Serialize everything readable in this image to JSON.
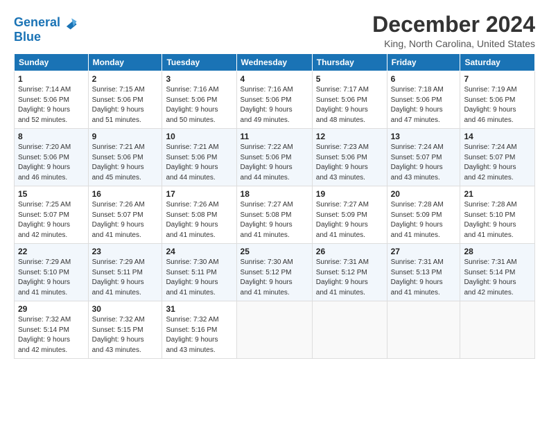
{
  "logo": {
    "line1": "General",
    "line2": "Blue"
  },
  "title": "December 2024",
  "subtitle": "King, North Carolina, United States",
  "days_of_week": [
    "Sunday",
    "Monday",
    "Tuesday",
    "Wednesday",
    "Thursday",
    "Friday",
    "Saturday"
  ],
  "weeks": [
    [
      {
        "day": "1",
        "info": "Sunrise: 7:14 AM\nSunset: 5:06 PM\nDaylight: 9 hours\nand 52 minutes."
      },
      {
        "day": "2",
        "info": "Sunrise: 7:15 AM\nSunset: 5:06 PM\nDaylight: 9 hours\nand 51 minutes."
      },
      {
        "day": "3",
        "info": "Sunrise: 7:16 AM\nSunset: 5:06 PM\nDaylight: 9 hours\nand 50 minutes."
      },
      {
        "day": "4",
        "info": "Sunrise: 7:16 AM\nSunset: 5:06 PM\nDaylight: 9 hours\nand 49 minutes."
      },
      {
        "day": "5",
        "info": "Sunrise: 7:17 AM\nSunset: 5:06 PM\nDaylight: 9 hours\nand 48 minutes."
      },
      {
        "day": "6",
        "info": "Sunrise: 7:18 AM\nSunset: 5:06 PM\nDaylight: 9 hours\nand 47 minutes."
      },
      {
        "day": "7",
        "info": "Sunrise: 7:19 AM\nSunset: 5:06 PM\nDaylight: 9 hours\nand 46 minutes."
      }
    ],
    [
      {
        "day": "8",
        "info": "Sunrise: 7:20 AM\nSunset: 5:06 PM\nDaylight: 9 hours\nand 46 minutes."
      },
      {
        "day": "9",
        "info": "Sunrise: 7:21 AM\nSunset: 5:06 PM\nDaylight: 9 hours\nand 45 minutes."
      },
      {
        "day": "10",
        "info": "Sunrise: 7:21 AM\nSunset: 5:06 PM\nDaylight: 9 hours\nand 44 minutes."
      },
      {
        "day": "11",
        "info": "Sunrise: 7:22 AM\nSunset: 5:06 PM\nDaylight: 9 hours\nand 44 minutes."
      },
      {
        "day": "12",
        "info": "Sunrise: 7:23 AM\nSunset: 5:06 PM\nDaylight: 9 hours\nand 43 minutes."
      },
      {
        "day": "13",
        "info": "Sunrise: 7:24 AM\nSunset: 5:07 PM\nDaylight: 9 hours\nand 43 minutes."
      },
      {
        "day": "14",
        "info": "Sunrise: 7:24 AM\nSunset: 5:07 PM\nDaylight: 9 hours\nand 42 minutes."
      }
    ],
    [
      {
        "day": "15",
        "info": "Sunrise: 7:25 AM\nSunset: 5:07 PM\nDaylight: 9 hours\nand 42 minutes."
      },
      {
        "day": "16",
        "info": "Sunrise: 7:26 AM\nSunset: 5:07 PM\nDaylight: 9 hours\nand 41 minutes."
      },
      {
        "day": "17",
        "info": "Sunrise: 7:26 AM\nSunset: 5:08 PM\nDaylight: 9 hours\nand 41 minutes."
      },
      {
        "day": "18",
        "info": "Sunrise: 7:27 AM\nSunset: 5:08 PM\nDaylight: 9 hours\nand 41 minutes."
      },
      {
        "day": "19",
        "info": "Sunrise: 7:27 AM\nSunset: 5:09 PM\nDaylight: 9 hours\nand 41 minutes."
      },
      {
        "day": "20",
        "info": "Sunrise: 7:28 AM\nSunset: 5:09 PM\nDaylight: 9 hours\nand 41 minutes."
      },
      {
        "day": "21",
        "info": "Sunrise: 7:28 AM\nSunset: 5:10 PM\nDaylight: 9 hours\nand 41 minutes."
      }
    ],
    [
      {
        "day": "22",
        "info": "Sunrise: 7:29 AM\nSunset: 5:10 PM\nDaylight: 9 hours\nand 41 minutes."
      },
      {
        "day": "23",
        "info": "Sunrise: 7:29 AM\nSunset: 5:11 PM\nDaylight: 9 hours\nand 41 minutes."
      },
      {
        "day": "24",
        "info": "Sunrise: 7:30 AM\nSunset: 5:11 PM\nDaylight: 9 hours\nand 41 minutes."
      },
      {
        "day": "25",
        "info": "Sunrise: 7:30 AM\nSunset: 5:12 PM\nDaylight: 9 hours\nand 41 minutes."
      },
      {
        "day": "26",
        "info": "Sunrise: 7:31 AM\nSunset: 5:12 PM\nDaylight: 9 hours\nand 41 minutes."
      },
      {
        "day": "27",
        "info": "Sunrise: 7:31 AM\nSunset: 5:13 PM\nDaylight: 9 hours\nand 41 minutes."
      },
      {
        "day": "28",
        "info": "Sunrise: 7:31 AM\nSunset: 5:14 PM\nDaylight: 9 hours\nand 42 minutes."
      }
    ],
    [
      {
        "day": "29",
        "info": "Sunrise: 7:32 AM\nSunset: 5:14 PM\nDaylight: 9 hours\nand 42 minutes."
      },
      {
        "day": "30",
        "info": "Sunrise: 7:32 AM\nSunset: 5:15 PM\nDaylight: 9 hours\nand 43 minutes."
      },
      {
        "day": "31",
        "info": "Sunrise: 7:32 AM\nSunset: 5:16 PM\nDaylight: 9 hours\nand 43 minutes."
      },
      {
        "day": "",
        "info": ""
      },
      {
        "day": "",
        "info": ""
      },
      {
        "day": "",
        "info": ""
      },
      {
        "day": "",
        "info": ""
      }
    ]
  ]
}
